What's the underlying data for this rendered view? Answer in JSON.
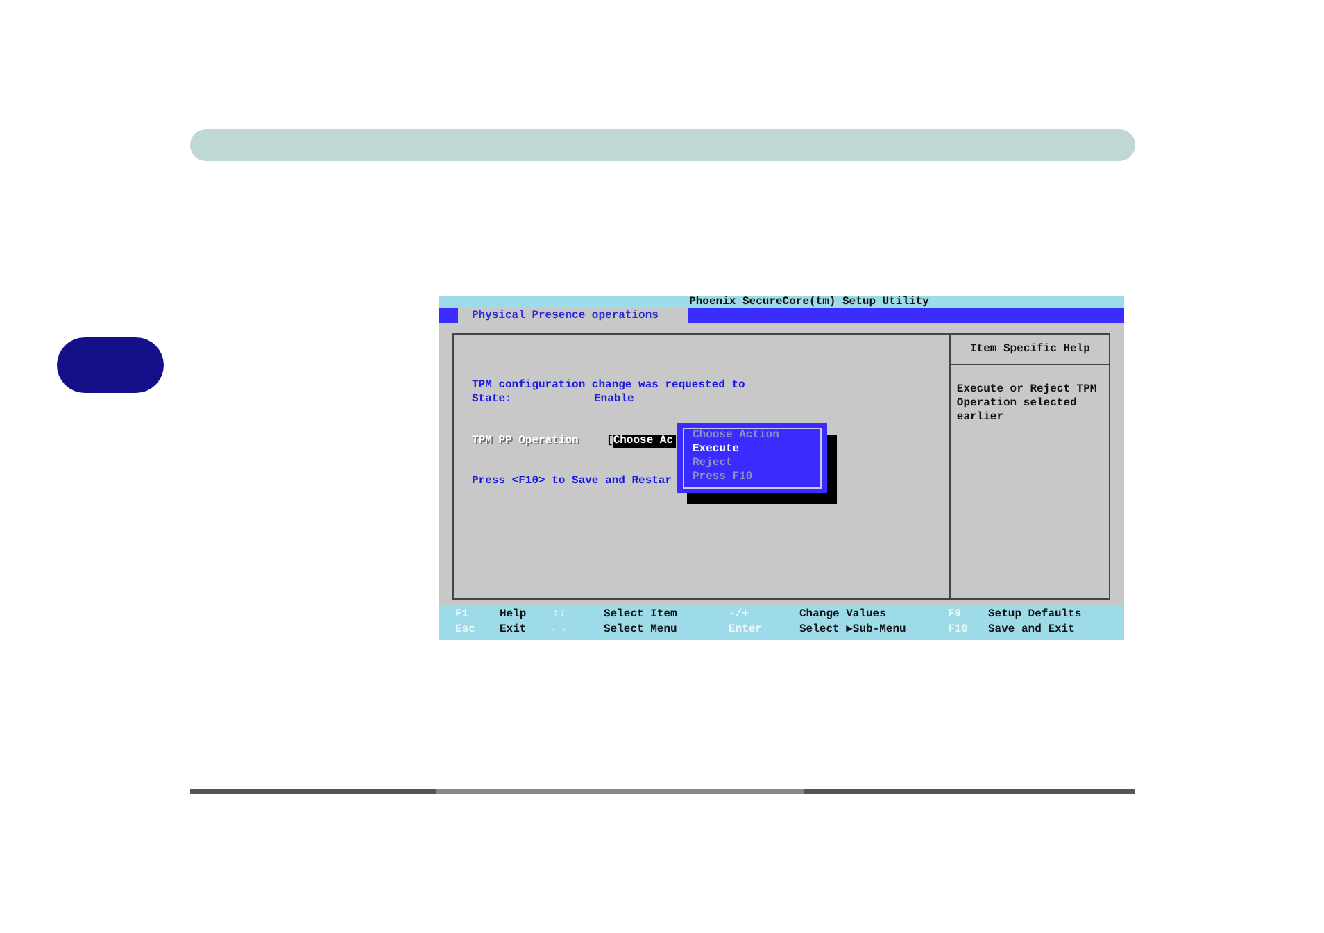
{
  "title": "Phoenix SecureCore(tm) Setup Utility",
  "tabs": [
    {
      "label": "Physical Presence operations",
      "selected": true
    }
  ],
  "message": {
    "line": "TPM configuration change was requested to",
    "state_label": "State:",
    "state_value": "Enable"
  },
  "field": {
    "label": "TPM PP Operation",
    "bracket": "[",
    "value": "Choose Ac",
    "highlighted": true
  },
  "hint": "Press <F10> to Save and Restar",
  "popup": {
    "items": [
      {
        "label": "Choose Action",
        "selected": false,
        "disabled": true
      },
      {
        "label": "Execute",
        "selected": true,
        "disabled": false
      },
      {
        "label": "Reject",
        "selected": false,
        "disabled": true
      },
      {
        "label": "Press F10",
        "selected": false,
        "disabled": true
      }
    ]
  },
  "help": {
    "title": "Item Specific Help",
    "text": "Execute or Reject TPM Operation selected earlier"
  },
  "footer": {
    "rows": [
      [
        {
          "key": "F1",
          "label": "Help"
        },
        {
          "key": "↑↓",
          "label": "Select Item"
        },
        {
          "key": "-/+",
          "label": "Change Values"
        },
        {
          "key": "F9",
          "label": "Setup Defaults"
        }
      ],
      [
        {
          "key": "Esc",
          "label": "Exit"
        },
        {
          "key": "←→",
          "label": "Select Menu"
        },
        {
          "key": "Enter",
          "label": "Select ▶Sub-Menu"
        },
        {
          "key": "F10",
          "label": "Save and Exit"
        }
      ]
    ]
  }
}
